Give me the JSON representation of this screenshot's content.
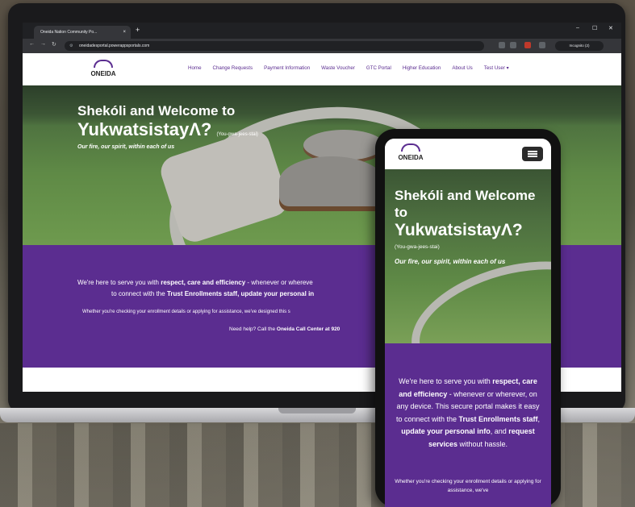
{
  "browser": {
    "tab_title": "Oneida Nation Community Po...",
    "tab_close": "×",
    "new_tab": "+",
    "url": "oneidadesportal.powerappsportals.com",
    "incognito_label": "Incognito (2)",
    "win_min": "–",
    "win_max": "☐",
    "win_close": "✕",
    "back": "←",
    "forward": "→",
    "reload": "↻"
  },
  "site": {
    "logo_text": "ONEIDA",
    "nav": [
      "Home",
      "Change Requests",
      "Payment Information",
      "Waste Voucher",
      "GTC Portal",
      "Higher Education",
      "About Us",
      "Test User ▾"
    ]
  },
  "hero": {
    "line1": "Shekóli and Welcome to",
    "line2": "YukwatsistayΛ?",
    "pronunciation": "(You-gwa-jees-stai)",
    "motto": "Our fire, our spirit, within each of us"
  },
  "purple": {
    "line1_a": "We're here to serve you with ",
    "line1_b": "respect, care and efficiency",
    "line1_c": " - whenever or whereve",
    "line2_a": "to connect with the ",
    "line2_b": "Trust Enrollments staff, update your personal in",
    "line3": "Whether you're checking your enrollment details or applying for assistance, we've designed this s",
    "line4_a": "Need help? Call the ",
    "line4_b": "Oneida Call Center",
    "line4_c": " at 920"
  },
  "phone": {
    "logo_text": "ONEIDA",
    "hero_line1": "Shekóli and Welcome to",
    "hero_line2": "YukwatsistayΛ?",
    "pronunciation": "(You-gwa-jees-stai)",
    "motto": "Our fire, our spirit, within each of us",
    "p_a": "We're here to serve you with ",
    "p_b": "respect, care and efficiency",
    "p_c": " - whenever or wherever, on any device. This secure portal makes it easy to connect with the ",
    "p_d": "Trust Enrollments staff",
    "p_e": ", ",
    "p_f": "update your personal info",
    "p_g": ", and ",
    "p_h": "request services",
    "p_i": " without hassle.",
    "p2": "Whether you're checking your enrollment details or applying for assistance, we've"
  },
  "colors": {
    "brand_purple": "#5b2d90"
  }
}
